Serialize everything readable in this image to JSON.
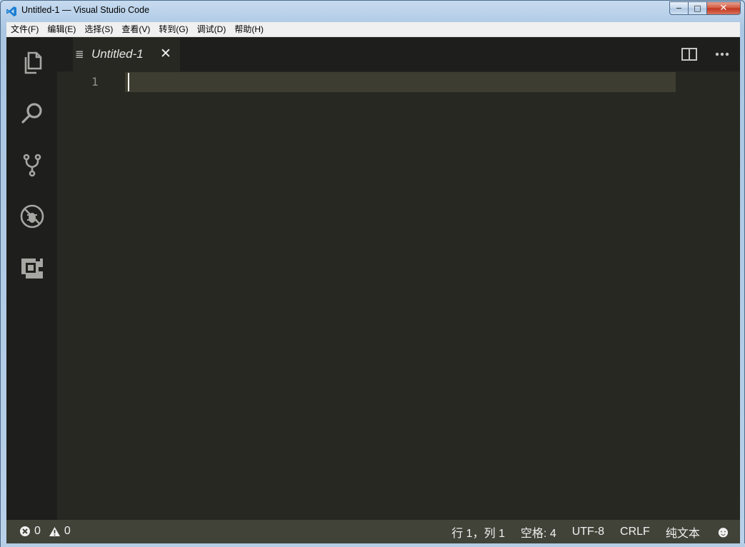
{
  "window": {
    "title": "Untitled-1 — Visual Studio Code",
    "controls": {
      "minimize": "−",
      "maximize": "□",
      "close": "✕"
    }
  },
  "menu": [
    "文件(F)",
    "编辑(E)",
    "选择(S)",
    "查看(V)",
    "转到(G)",
    "调试(D)",
    "帮助(H)"
  ],
  "activity_bar": [
    "files-icon",
    "search-icon",
    "source-control-icon",
    "debug-icon",
    "extensions-icon"
  ],
  "tab": {
    "icon": "≣",
    "label": "Untitled-1",
    "close": "✕"
  },
  "tab_actions": [
    "split-editor-icon",
    "more-actions-icon"
  ],
  "editor": {
    "line_number": "1",
    "content": ""
  },
  "status": {
    "errors": "0",
    "warnings": "0",
    "position": "行 1，列 1",
    "indent": "空格: 4",
    "encoding": "UTF-8",
    "eol": "CRLF",
    "language": "纯文本",
    "feedback": "☻"
  },
  "colors": {
    "editor_bg": "#272822",
    "activity_bar_bg": "#1e1f1c",
    "status_bar_bg": "#414339",
    "line_highlight": "#3e3d32",
    "accent": "#007acc"
  }
}
